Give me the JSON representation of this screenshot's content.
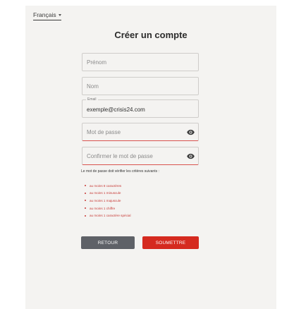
{
  "language": {
    "selected": "Français"
  },
  "form": {
    "title": "Créer un compte",
    "first_name": {
      "placeholder": "Prénom",
      "value": ""
    },
    "last_name": {
      "placeholder": "Nom",
      "value": ""
    },
    "email": {
      "label": "Email",
      "value": "exemple@crisis24.com"
    },
    "password": {
      "placeholder": "Mot de passe",
      "value": ""
    },
    "confirm_password": {
      "placeholder": "Confirmer le mot de passe",
      "value": ""
    }
  },
  "criteria": {
    "title": "Le mot de passe doit vérifier les critères suivants :",
    "items": [
      "au moins 8 caractères",
      "au moins 1 minuscule",
      "au moins 1 majuscule",
      "au moins 1 chiffre",
      "au moins 1 caractère spécial"
    ]
  },
  "buttons": {
    "back": "RETOUR",
    "submit": "SOUMETTRE"
  },
  "colors": {
    "accent": "#d52a1f",
    "secondary": "#5e6167",
    "error": "#c73a36"
  },
  "icons": {
    "password_toggle": "eye-icon",
    "language_dropdown": "chevron-down-icon"
  }
}
